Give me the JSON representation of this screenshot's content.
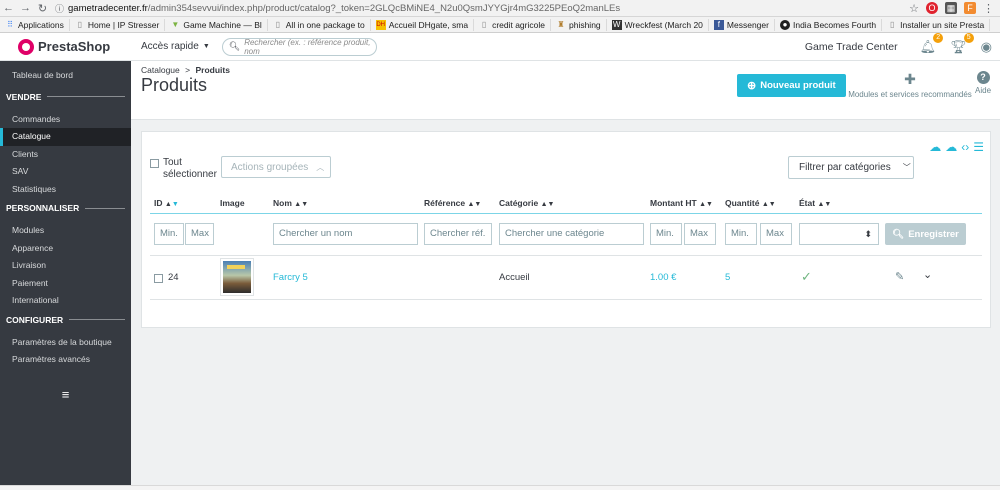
{
  "browser": {
    "url_host": "gametradecenter.fr",
    "url_path": "/admin354sevvui/index.php/product/catalog?_token=2GLQcBMiNE4_N2u0QsmJYYGjr4mG3225PEoQ2manLEs",
    "bookmarks": [
      "Applications",
      "Home | IP Stresser",
      "Game Machine — Bl",
      "All in one package to",
      "Accueil DHgate, sma",
      "credit agricole",
      "phishing",
      "Wreckfest (March 20",
      "Messenger",
      "India Becomes Fourth",
      "Installer un site Presta"
    ]
  },
  "header": {
    "logo": "PrestaShop",
    "quick_access": "Accès rapide",
    "search_placeholder": "Rechercher (ex. : référence produit, nom",
    "shop_name": "Game Trade Center",
    "notif_badge": "2",
    "orders_badge": "5"
  },
  "sidebar": {
    "dashboard": "Tableau de bord",
    "section_sell": "VENDRE",
    "sell_items": [
      "Commandes",
      "Catalogue",
      "Clients",
      "SAV",
      "Statistiques"
    ],
    "section_customize": "PERSONNALISER",
    "customize_items": [
      "Modules",
      "Apparence",
      "Livraison",
      "Paiement",
      "International"
    ],
    "section_configure": "CONFIGURER",
    "configure_items": [
      "Paramètres de la boutique",
      "Paramètres avancés"
    ]
  },
  "page": {
    "breadcrumb_parent": "Catalogue",
    "breadcrumb_sep": ">",
    "breadcrumb_current": "Produits",
    "title": "Produits",
    "new_product": "Nouveau produit",
    "modules_link": "Modules et services recommandés",
    "help_link": "Aide"
  },
  "toolbar": {
    "select_all": "Tout sélectionner",
    "bulk_actions": "Actions groupées",
    "category_filter": "Filtrer par catégories"
  },
  "table": {
    "columns": {
      "id": "ID",
      "image": "Image",
      "name": "Nom",
      "reference": "Référence",
      "category": "Catégorie",
      "price": "Montant HT",
      "quantity": "Quantité",
      "status": "État"
    },
    "filters": {
      "min": "Min.",
      "max": "Max",
      "name_placeholder": "Chercher un nom",
      "reference_placeholder": "Chercher réf.",
      "category_placeholder": "Chercher une catégorie",
      "save": "Enregistrer"
    },
    "rows": [
      {
        "id": "24",
        "name": "Farcry 5",
        "reference": "",
        "category": "Accueil",
        "price": "1.00 €",
        "quantity": "5",
        "status": "active"
      }
    ]
  },
  "colors": {
    "accent": "#25b9d7",
    "sidebar_bg": "#363a41",
    "brand_pink": "#df0067"
  }
}
